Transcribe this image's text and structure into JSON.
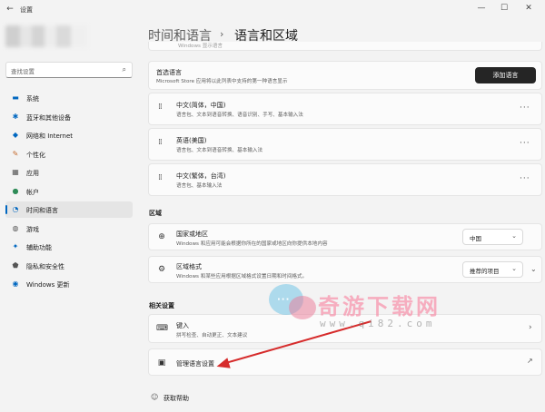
{
  "window": {
    "app_title": "设置",
    "back": "←",
    "min": "—",
    "max": "☐",
    "close": "✕"
  },
  "sidebar": {
    "search_placeholder": "查找设置",
    "items": [
      {
        "icon": "system-icon",
        "glyph": "▬",
        "label": "系统",
        "color": "#0067c0"
      },
      {
        "icon": "bluetooth-icon",
        "glyph": "✱",
        "label": "蓝牙和其他设备",
        "color": "#0067c0"
      },
      {
        "icon": "wifi-icon",
        "glyph": "◆",
        "label": "网络和 Internet",
        "color": "#0067c0"
      },
      {
        "icon": "personalization-icon",
        "glyph": "✎",
        "label": "个性化",
        "color": "#c46a2c"
      },
      {
        "icon": "apps-icon",
        "glyph": "▦",
        "label": "应用",
        "color": "#555555"
      },
      {
        "icon": "accounts-icon",
        "glyph": "●",
        "label": "帐户",
        "color": "#2e8b57"
      },
      {
        "icon": "time-language-icon",
        "glyph": "◔",
        "label": "时间和语言",
        "color": "#0067c0"
      },
      {
        "icon": "gaming-icon",
        "glyph": "◍",
        "label": "游戏",
        "color": "#555555"
      },
      {
        "icon": "accessibility-icon",
        "glyph": "✦",
        "label": "辅助功能",
        "color": "#0067c0"
      },
      {
        "icon": "privacy-icon",
        "glyph": "⬟",
        "label": "隐私和安全性",
        "color": "#555555"
      },
      {
        "icon": "windows-update-icon",
        "glyph": "◉",
        "label": "Windows 更新",
        "color": "#0067c0"
      }
    ]
  },
  "header": {
    "parent": "时间和语言",
    "separator": "›",
    "current": "语言和区域"
  },
  "top_fragment": "Windows 显示语言",
  "preferred": {
    "title": "首选语言",
    "subtitle": "Microsoft Store 应用将以此列表中支持的第一种语言显示",
    "add_button": "添加语言"
  },
  "languages": [
    {
      "name": "中文(简体，中国)",
      "detail": "语言包、文本到语音转换、语音识别、手写、基本输入法"
    },
    {
      "name": "英语(美国)",
      "detail": "语言包、文本到语音转换、基本输入法"
    },
    {
      "name": "中文(繁体，台湾)",
      "detail": "语言包、基本输入法"
    }
  ],
  "more_glyph": "···",
  "grip_glyph": "⁞⁞",
  "region": {
    "label": "区域",
    "country": {
      "title": "国家或地区",
      "subtitle": "Windows 和应用可能会根据你所在的国家或地区向你提供本地内容",
      "value": "中国"
    },
    "format": {
      "title": "区域格式",
      "subtitle": "Windows 和某些应用根据区域格式设置日期和时间格式。",
      "value": "推荐的项目"
    }
  },
  "related": {
    "label": "相关设置",
    "typing": {
      "title": "键入",
      "subtitle": "拼写检查、自动更正、文本建议"
    },
    "admin": {
      "title": "管理语言设置"
    }
  },
  "help": {
    "get_help": "获取帮助"
  },
  "watermark": {
    "text": "奇游下载网",
    "url": "www.qi82.com"
  },
  "colors": {
    "accent": "#0067c0",
    "annotation_arrow": "#d62b2b"
  }
}
